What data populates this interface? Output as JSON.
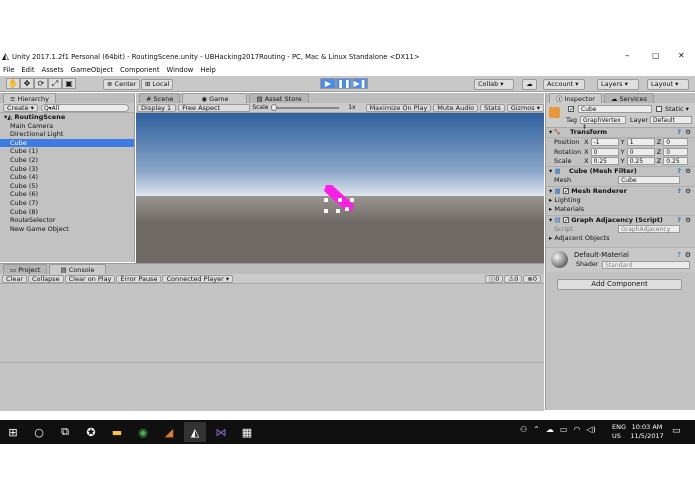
{
  "window": {
    "title": "Unity 2017.1.2f1 Personal (64bit) - RoutingScene.unity - UBHacking2017Routing - PC, Mac & Linux Standalone <DX11>",
    "controls": {
      "minimize": "–",
      "maximize": "▢",
      "close": "✕"
    }
  },
  "menu": [
    "File",
    "Edit",
    "Assets",
    "GameObject",
    "Component",
    "Window",
    "Help"
  ],
  "toolbar": {
    "pivot": "Center",
    "space": "Local",
    "collab": "Collab ▾",
    "account": "Account ▾",
    "layers": "Layers ▾",
    "layout": "Layout ▾"
  },
  "hierarchy": {
    "tab": "Hierarchy",
    "create": "Create ▾",
    "search": "Q▾All",
    "scene": "RoutingScene",
    "items": [
      "Main Camera",
      "Directional Light",
      "Cube",
      "Cube (1)",
      "Cube (2)",
      "Cube (3)",
      "Cube (4)",
      "Cube (5)",
      "Cube (6)",
      "Cube (7)",
      "Cube (8)",
      "RouteSelector",
      "New Game Object"
    ],
    "selected_index": 2
  },
  "game_view": {
    "tabs": [
      "Scene",
      "Game",
      "Asset Store"
    ],
    "active_tab": "Game",
    "display": "Display 1",
    "aspect": "Free Aspect",
    "scale_label": "Scale",
    "scale_value": "1x",
    "options": [
      "Maximize On Play",
      "Mute Audio",
      "Stats",
      "Gizmos ▾"
    ],
    "sky_color": "#2e5f9e",
    "ground_color": "#6f6a66",
    "object_color": "#ff1ee6"
  },
  "bottom": {
    "tabs": [
      "Project",
      "Console"
    ],
    "active_tab": "Console",
    "buttons": [
      "Clear",
      "Collapse",
      "Clear on Play",
      "Error Pause",
      "Connected Player ▾"
    ],
    "counts": [
      "0",
      "0",
      "0"
    ]
  },
  "inspector": {
    "tabs": [
      "Inspector",
      "Services"
    ],
    "object_name": "Cube",
    "static_label": "Static ▾",
    "tag_label": "Tag",
    "tag_value": "GraphVertex ‡",
    "layer_label": "Layer",
    "layer_value": "Default",
    "transform": {
      "title": "Transform",
      "rows": [
        {
          "label": "Position",
          "x": "-1",
          "y": "1",
          "z": "0"
        },
        {
          "label": "Rotation",
          "x": "0",
          "y": "0",
          "z": "0"
        },
        {
          "label": "Scale",
          "x": "0.25",
          "y": "0.25",
          "z": "0.25"
        }
      ]
    },
    "mesh_filter": {
      "title": "Cube (Mesh Filter)",
      "label": "Mesh",
      "value": "Cube"
    },
    "mesh_renderer": {
      "title": "Mesh Renderer",
      "items": [
        "Lighting",
        "Materials"
      ]
    },
    "graph_adjacency": {
      "title": "Graph Adjacency (Script)",
      "script_label": "Script",
      "script_value": "GraphAdjacency",
      "list": "Adjacent Objects"
    },
    "material": {
      "name": "Default-Material",
      "shader_label": "Shader",
      "shader_value": "Standard"
    },
    "add_component": "Add Component"
  },
  "taskbar": {
    "lang": "ENG",
    "region": "US",
    "time": "10:03 AM",
    "date": "11/5/2017"
  }
}
